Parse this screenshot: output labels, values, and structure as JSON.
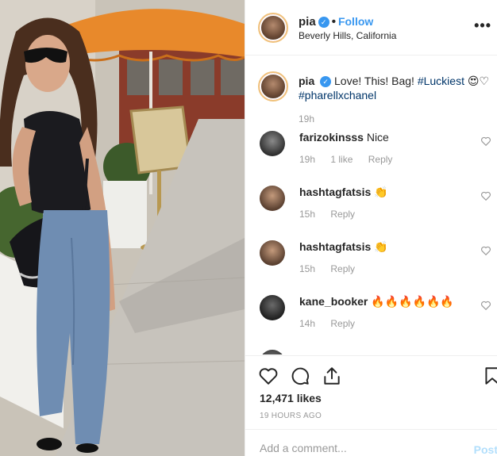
{
  "post": {
    "username": "pia",
    "follow_label": "Follow",
    "separator": "•",
    "location": "Beverly Hills, California",
    "more_label": "•••"
  },
  "caption": {
    "username": "pia",
    "text": "Love! This! Bag!",
    "hashtag1": "#Luckiest",
    "emoji": "😍♡",
    "hashtag2": "#pharellxchanel",
    "time": "19h"
  },
  "comments": [
    {
      "username": "farizokinsss",
      "text": "Nice",
      "time": "19h",
      "likes": "1 like",
      "reply": "Reply"
    },
    {
      "username": "hashtagfatsis",
      "text": "👏",
      "time": "15h",
      "reply": "Reply"
    },
    {
      "username": "hashtagfatsis",
      "text": "👏",
      "time": "15h",
      "reply": "Reply"
    },
    {
      "username": "kane_booker",
      "text": "🔥🔥🔥🔥🔥🔥",
      "time": "14h",
      "reply": "Reply"
    }
  ],
  "stats": {
    "likes": "12,471 likes",
    "time_ago": "19 HOURS AGO"
  },
  "add_comment": {
    "placeholder": "Add a comment...",
    "post_label": "Post"
  },
  "colors": {
    "link_blue": "#3897f0",
    "hashtag": "#003569",
    "umbrella": "#e8892b"
  },
  "icons": [
    "heart-icon",
    "comment-icon",
    "share-icon",
    "bookmark-icon",
    "verified-icon",
    "more-icon"
  ]
}
